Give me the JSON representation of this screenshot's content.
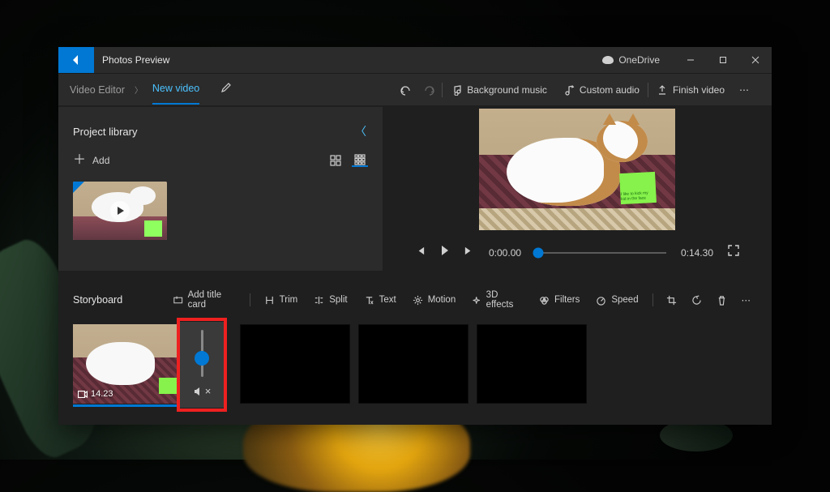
{
  "titlebar": {
    "app_title": "Photos Preview",
    "onedrive_label": "OneDrive"
  },
  "breadcrumbs": {
    "root": "Video Editor",
    "current": "New video"
  },
  "cmdbar": {
    "bg_music": "Background music",
    "custom_audio": "Custom audio",
    "finish": "Finish video"
  },
  "library": {
    "title": "Project library",
    "add_label": "Add"
  },
  "player": {
    "time_current": "0:00.00",
    "time_total": "0:14.30"
  },
  "storyboard": {
    "title": "Storyboard",
    "add_title_card": "Add title card",
    "trim": "Trim",
    "split": "Split",
    "text": "Text",
    "motion": "Motion",
    "effects": "3D effects",
    "filters": "Filters",
    "speed": "Speed",
    "clip_duration": "14.23"
  },
  "preview_note": "I like to kick my kid in the face"
}
